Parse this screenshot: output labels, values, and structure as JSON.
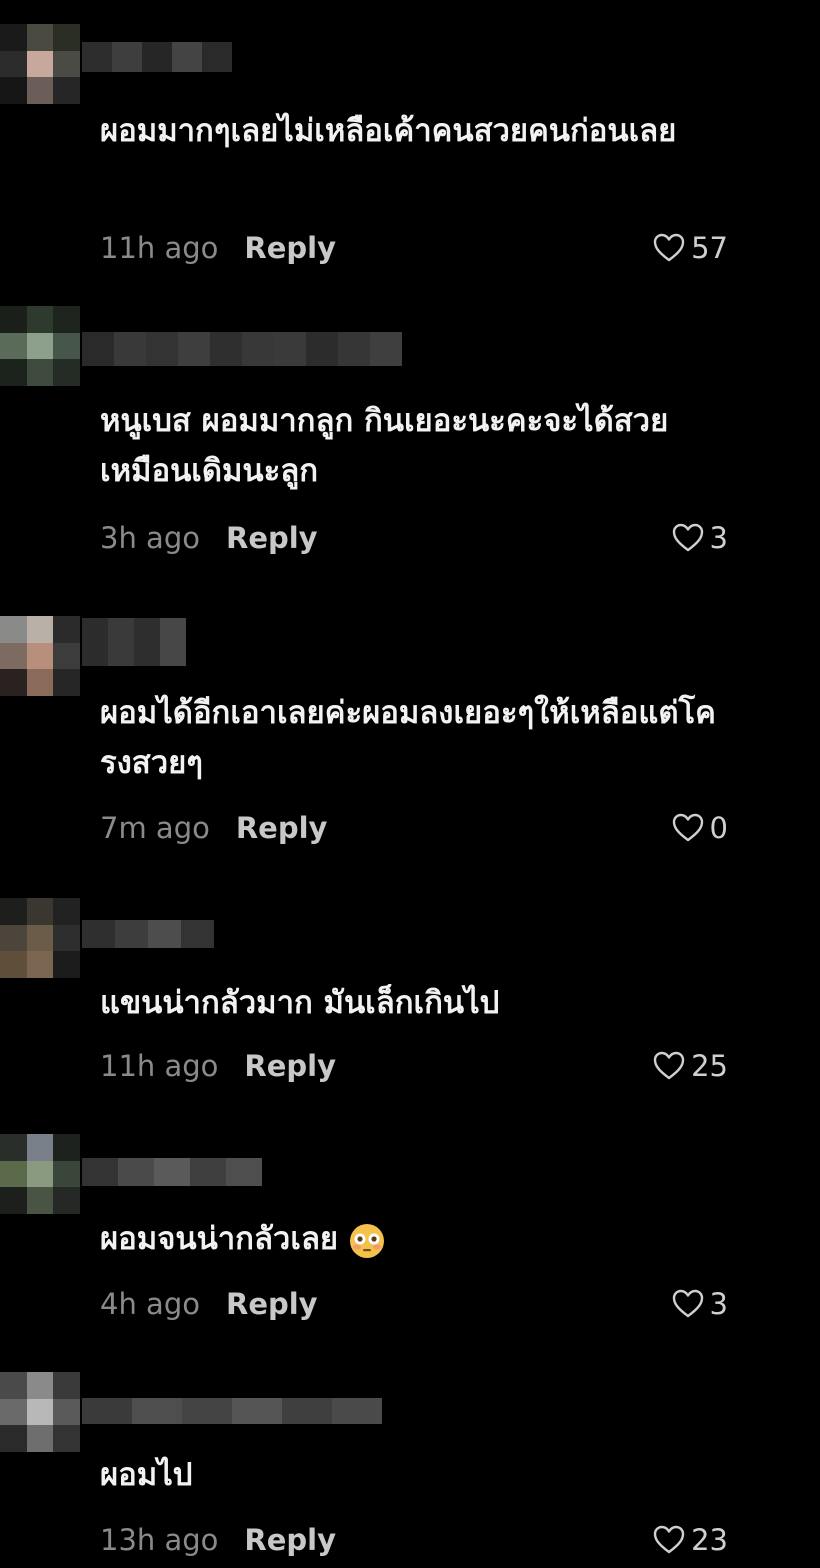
{
  "comments": [
    {
      "text": "ผอมมากๆเลยไม่เหลือเค้าคนสวยคนก่อนเลย",
      "time": "11h ago",
      "reply": "Reply",
      "likes": "57"
    },
    {
      "text": "หนูเบส ผอมมากลูก กินเยอะนะคะจะได้สวยเหมือนเดิมนะลูก",
      "time": "3h ago",
      "reply": "Reply",
      "likes": "3"
    },
    {
      "text": "ผอมได้อีกเอาเลยค่ะผอมลงเยอะๆให้เหลือแต่โครงสวยๆ",
      "time": "7m ago",
      "reply": "Reply",
      "likes": "0"
    },
    {
      "text": "แขนน่ากลัวมาก มันเล็กเกินไป",
      "time": "11h ago",
      "reply": "Reply",
      "likes": "25"
    },
    {
      "text": "ผอมจนน่ากลัวเลย",
      "emoji": "flushed-face-emoji",
      "time": "4h ago",
      "reply": "Reply",
      "likes": "3"
    },
    {
      "text": "ผอมไป",
      "time": "13h ago",
      "reply": "Reply",
      "likes": "23"
    }
  ],
  "icons": {
    "like": "heart-outline-icon"
  },
  "colors": {
    "background": "#000000",
    "text": "#f2f2f2",
    "timestamp": "#8a8a8a",
    "reply": "#c8c8c8"
  }
}
